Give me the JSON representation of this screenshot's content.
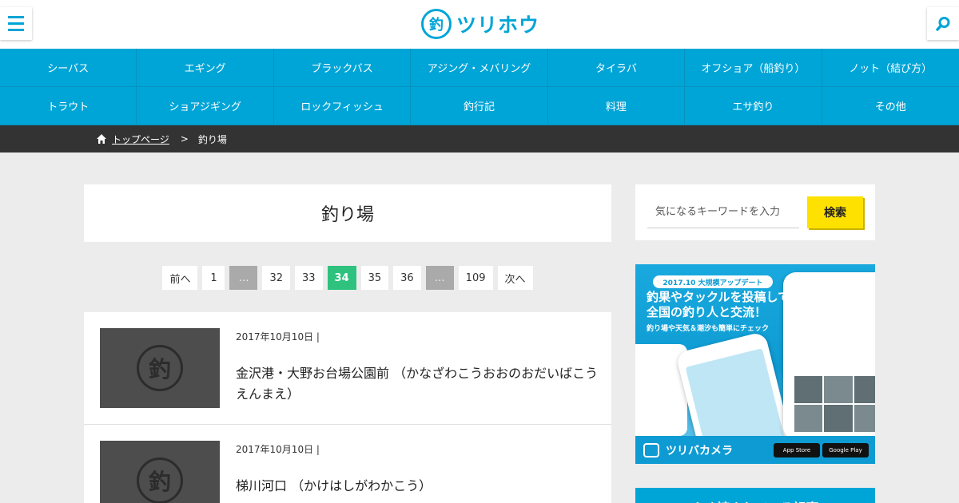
{
  "header": {
    "logo_mark": "釣",
    "logo_text": "ツリホウ"
  },
  "nav": {
    "items": [
      {
        "label": "シーバス"
      },
      {
        "label": "エギング"
      },
      {
        "label": "ブラックバス"
      },
      {
        "label": "アジング・メバリング"
      },
      {
        "label": "タイラバ"
      },
      {
        "label": "オフショア（船釣り）"
      },
      {
        "label": "ノット（結び方）"
      },
      {
        "label": "トラウト"
      },
      {
        "label": "ショアジギング"
      },
      {
        "label": "ロックフィッシュ"
      },
      {
        "label": "釣行記"
      },
      {
        "label": "料理"
      },
      {
        "label": "エサ釣り"
      },
      {
        "label": "その他"
      }
    ]
  },
  "breadcrumb": {
    "home": "トップページ",
    "separator": ">",
    "current": "釣り場"
  },
  "main": {
    "title": "釣り場"
  },
  "pagination": {
    "prev": "前へ",
    "first": "1",
    "dots": "…",
    "p32": "32",
    "p33": "33",
    "current": "34",
    "p35": "35",
    "p36": "36",
    "last": "109",
    "next": "次へ"
  },
  "posts": [
    {
      "thumb_mark": "釣",
      "date": "2017年10月10日 |",
      "title": "金沢港・大野お台場公園前 （かなざわこうおおのおだいばこうえんまえ）"
    },
    {
      "thumb_mark": "釣",
      "date": "2017年10月10日 |",
      "title": "梯川河口 （かけはしがわかこう）"
    }
  ],
  "sidebar": {
    "search_placeholder": "気になるキーワードを入力",
    "search_button": "検索",
    "ad": {
      "pill": "2017.10 大規模アップデート",
      "headline": "釣果やタックルを投稿して全国の釣り人と交流！",
      "sub": "釣り場や天気＆潮汐も簡単にチェック",
      "app_name": "ツリバカメラ",
      "app_store": "App Store",
      "google_play": "Google Play"
    },
    "next_box_title": "よく読まれている記事"
  },
  "colors": {
    "brand": "#00a5d7",
    "current_page": "#2ec27e",
    "search_button": "#ffe100",
    "breadcrumb_bg": "#333333"
  }
}
